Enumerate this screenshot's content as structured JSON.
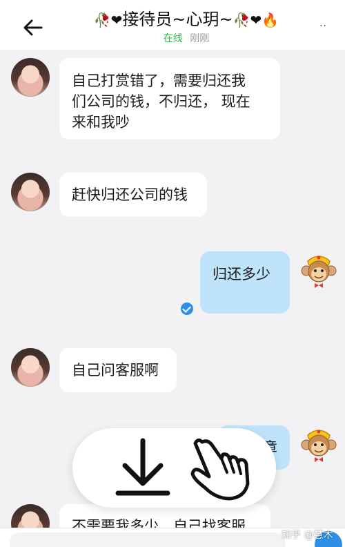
{
  "header": {
    "title_left_deco": "🥀❤",
    "title": "接待员~心玥~",
    "title_right_deco": "🥀❤🔥",
    "status_online": "在线",
    "status_time": "刚刚",
    "more": ".."
  },
  "messages": [
    {
      "side": "in",
      "text_lines": [
        "自己打赏错了，需要归还我",
        "们公司的钱，不归还， 现在",
        "来和我吵"
      ]
    },
    {
      "side": "in",
      "text": "赶快归还公司的钱"
    },
    {
      "side": "out",
      "text": "归还多少"
    },
    {
      "side": "in",
      "text": "自己问客服啊"
    },
    {
      "side": "out",
      "text_partial": "章"
    },
    {
      "side": "in",
      "text_partial": "不需要我多少，自己找客服"
    }
  ],
  "watermark": "知乎 @慧木",
  "colors": {
    "bubble_out": "#bfe3fb",
    "online_green": "#36b24a",
    "accent_blue": "#2f8fe8"
  }
}
